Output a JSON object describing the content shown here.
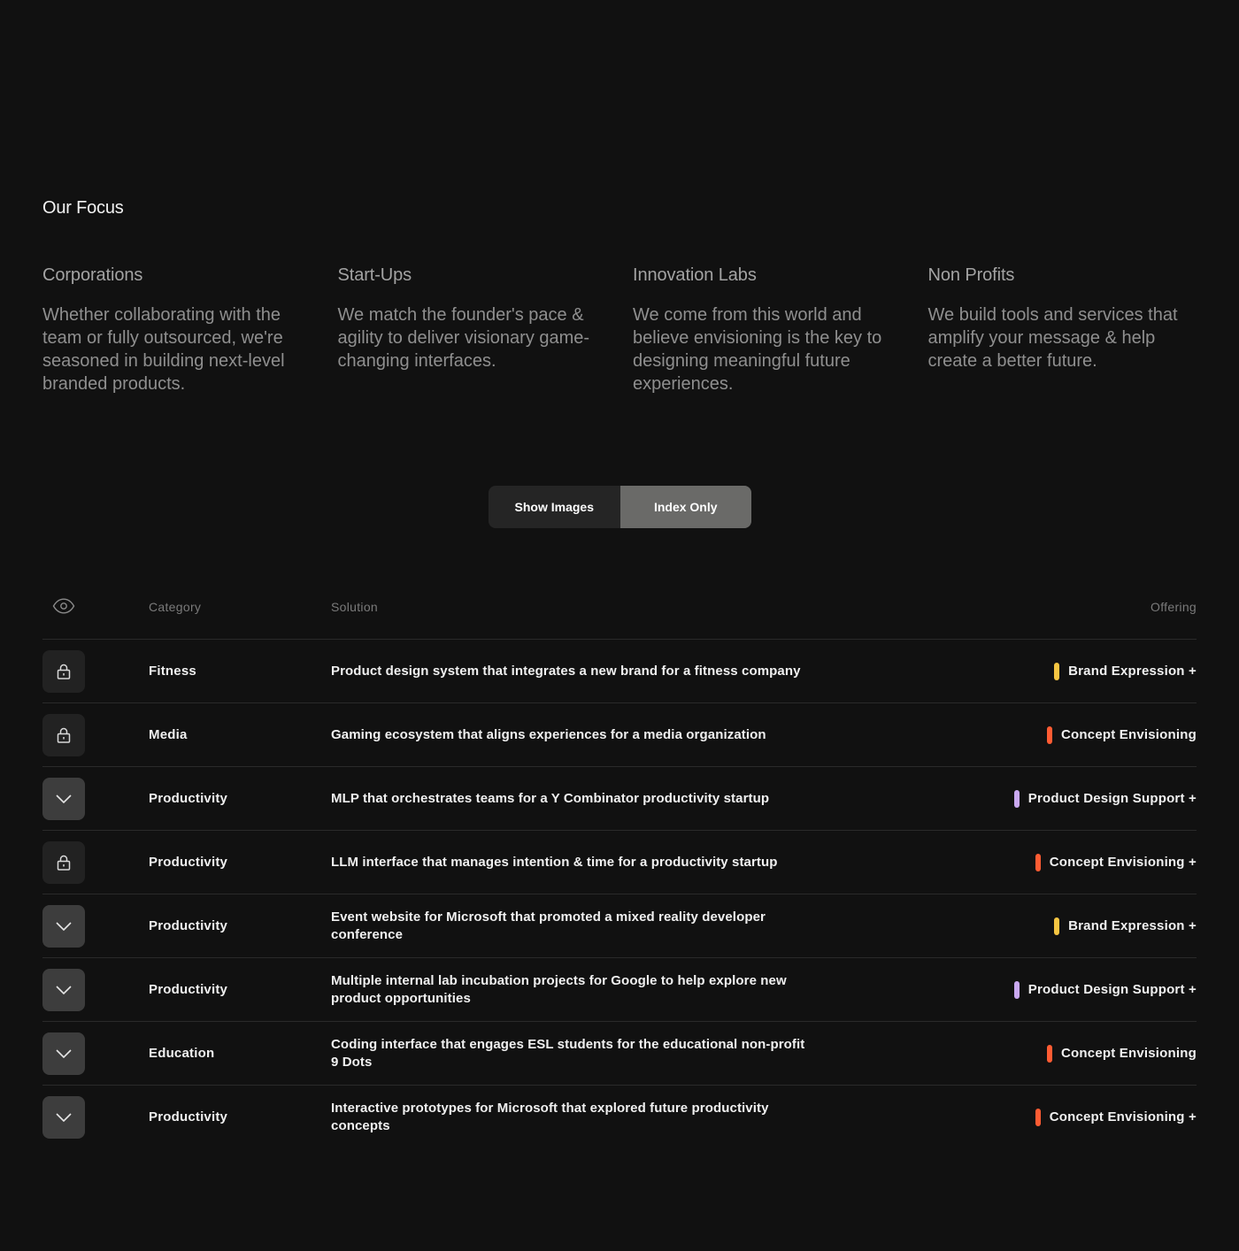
{
  "focus": {
    "title": "Our Focus",
    "columns": [
      {
        "heading": "Corporations",
        "text": "Whether collaborating with the team or fully outsourced, we're seasoned in building next-level branded products."
      },
      {
        "heading": "Start-Ups",
        "text": "We match the founder's pace & agility to deliver visionary game-changing interfaces."
      },
      {
        "heading": "Innovation Labs",
        "text": "We come from this world and believe envisioning is the key to designing meaningful future experiences."
      },
      {
        "heading": "Non Profits",
        "text": "We build tools and services that amplify your message & help create a better future."
      }
    ]
  },
  "toggle": {
    "show_images": "Show Images",
    "index_only": "Index Only",
    "active": "index_only"
  },
  "table": {
    "headers": {
      "category": "Category",
      "solution": "Solution",
      "offering": "Offering"
    },
    "rows": [
      {
        "state": "locked",
        "category": "Fitness",
        "solution": "Product design system that integrates a new brand for a fitness company",
        "offering": "Brand Expression +",
        "color": "#f5c542"
      },
      {
        "state": "locked",
        "category": "Media",
        "solution": "Gaming ecosystem that aligns experiences for a media organization",
        "offering": "Concept Envisioning",
        "color": "#ff5c33"
      },
      {
        "state": "open",
        "category": "Productivity",
        "solution": "MLP that orchestrates teams for a Y Combinator productivity startup",
        "offering": "Product Design Support +",
        "color": "#c9a8f0"
      },
      {
        "state": "locked",
        "category": "Productivity",
        "solution": "LLM interface that manages intention & time for a productivity startup",
        "offering": "Concept Envisioning +",
        "color": "#ff5c33"
      },
      {
        "state": "open",
        "category": "Productivity",
        "solution": "Event website for Microsoft that promoted a mixed reality developer conference",
        "offering": "Brand Expression +",
        "color": "#f5c542"
      },
      {
        "state": "open",
        "category": "Productivity",
        "solution": "Multiple internal lab incubation projects for Google to help explore new product opportunities",
        "offering": "Product Design Support +",
        "color": "#c9a8f0"
      },
      {
        "state": "open",
        "category": "Education",
        "solution": "Coding interface that engages ESL students for the educational non-profit 9 Dots",
        "offering": "Concept Envisioning",
        "color": "#ff5c33"
      },
      {
        "state": "open",
        "category": "Productivity",
        "solution": "Interactive prototypes for Microsoft that explored future productivity concepts",
        "offering": "Concept Envisioning +",
        "color": "#ff5c33"
      }
    ]
  }
}
